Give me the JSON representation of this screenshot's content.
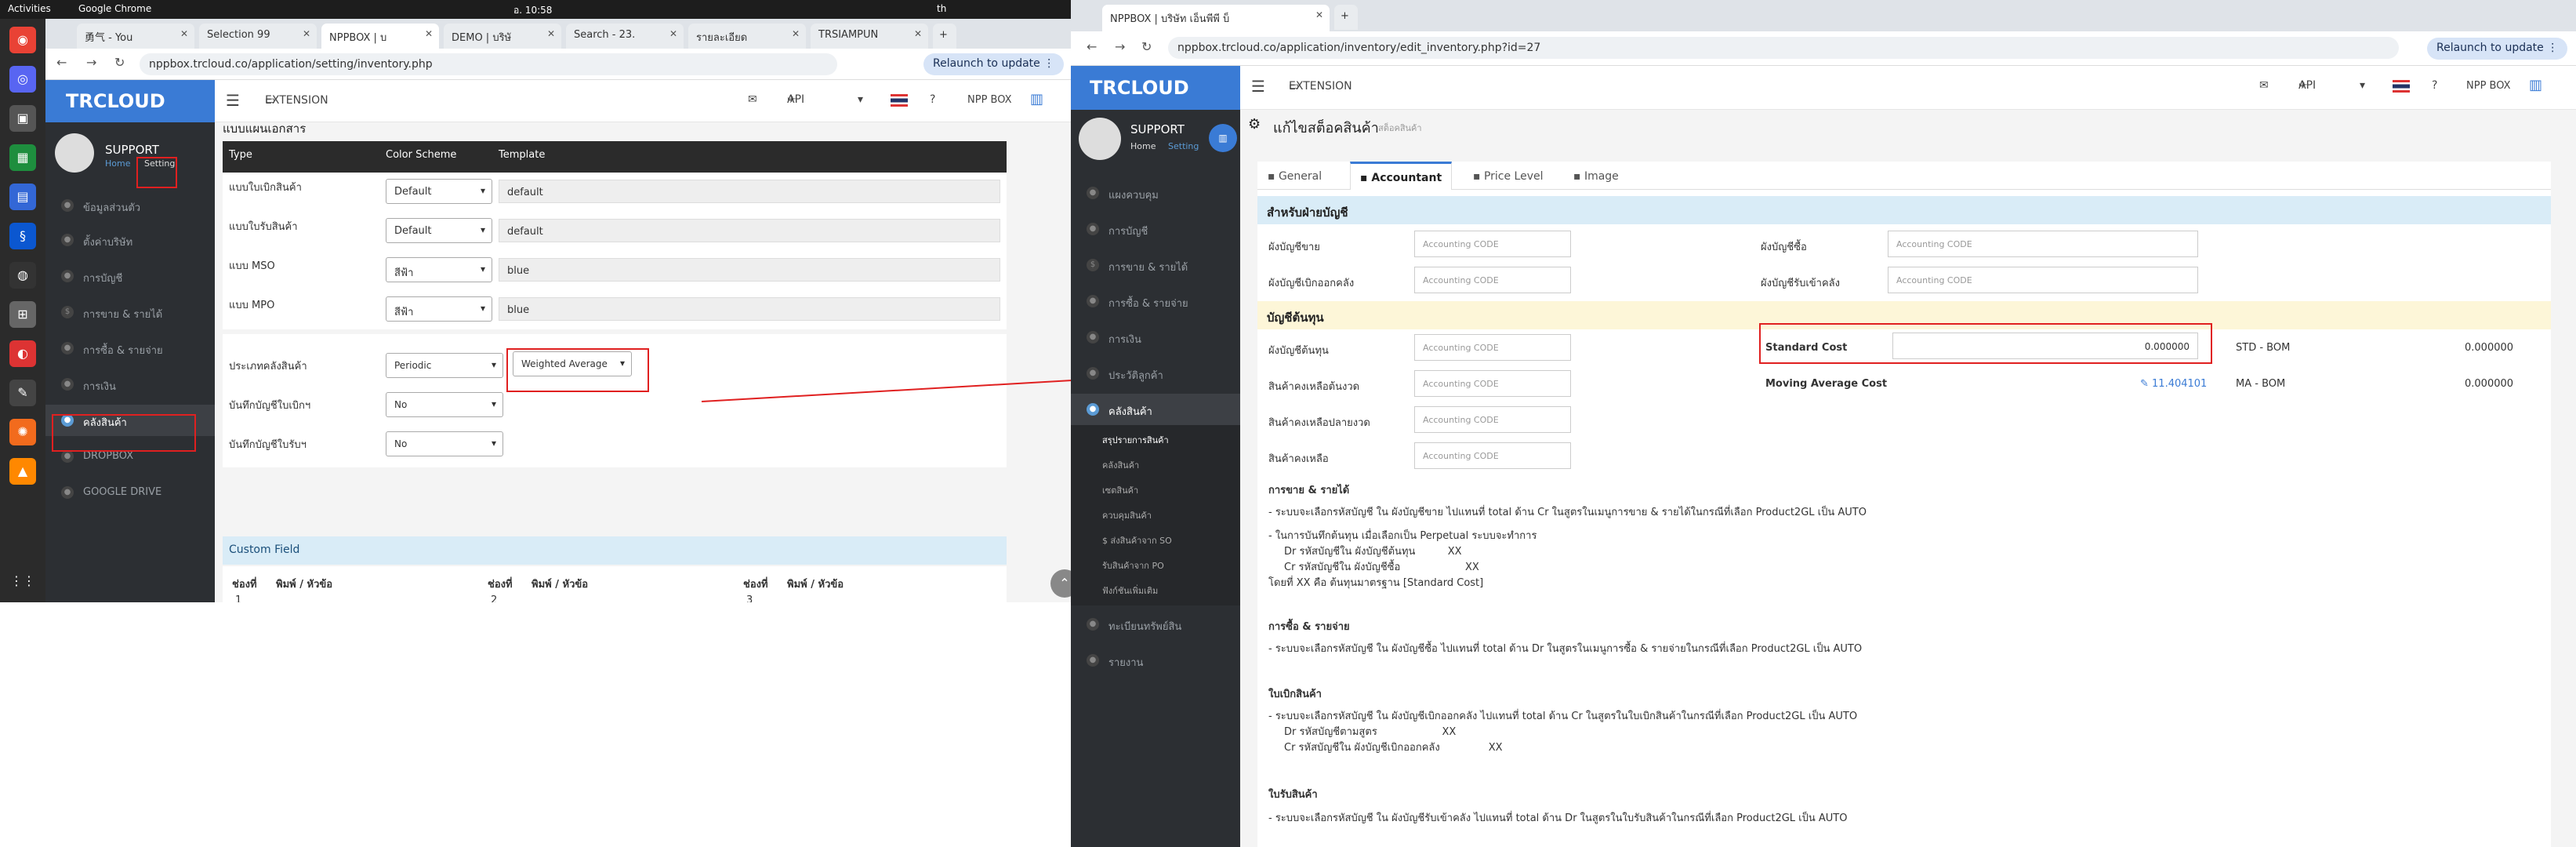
{
  "system": {
    "activities": "Activities",
    "app": "Google Chrome",
    "clock": "อ. 10:58",
    "lang": "th"
  },
  "left": {
    "tabs": [
      "勇气 - You",
      "Selection 99",
      "NPPBOX | บ",
      "DEMO | บริษั",
      "Search - 23.",
      "รายละเอียด",
      "TRSIAMPUN"
    ],
    "url": "nppbox.trcloud.co/application/setting/inventory.php",
    "relaunch": "Relaunch to update",
    "logo": "TRCLOUD",
    "extension": "EXTENSION",
    "api": "API",
    "company": "NPP BOX",
    "user": {
      "name": "SUPPORT",
      "home": "Home",
      "setting": "Setting"
    },
    "menu": [
      "ข้อมูลส่วนตัว",
      "ตั้งค่าบริษัท",
      "การบัญชี",
      "การขาย & รายได้",
      "การซื้อ & รายจ่าย",
      "การเงิน",
      "คลังสินค้า",
      "DROPBOX",
      "GOOGLE DRIVE"
    ],
    "section_title": "แบบแผนเอกสาร",
    "table_head": [
      "Type",
      "Color Scheme",
      "Template"
    ],
    "rows": [
      {
        "type": "แบบใบเบิกสินค้า",
        "scheme": "Default",
        "template": "default"
      },
      {
        "type": "แบบใบรับสินค้า",
        "scheme": "Default",
        "template": "default"
      },
      {
        "type": "แบบ MSO",
        "scheme": "สีฟ้า",
        "template": "blue"
      },
      {
        "type": "แบบ MPO",
        "scheme": "สีฟ้า",
        "template": "blue"
      }
    ],
    "inv_type_label": "ประเภทคลังสินค้า",
    "inv_type": "Periodic",
    "cost_method": "Weighted Average",
    "opt1_label": "บันทึกบัญชีใบเบิกฯ",
    "opt1": "No",
    "opt2_label": "บันทึกบัญชีใบรับฯ",
    "opt2": "No",
    "custom_field": "Custom Field",
    "cf_head": [
      "ช่องที่",
      "พิมพ์ / หัวข้อ",
      "ช่องที่",
      "พิมพ์ / หัวข้อ",
      "ช่องที่",
      "พิมพ์ / หัวข้อ"
    ],
    "cf_nums": [
      "1",
      "2",
      "3"
    ]
  },
  "right": {
    "tab": "NPPBOX | บริษัท เอ็นพีพี บ็",
    "url": "nppbox.trcloud.co/application/inventory/edit_inventory.php?id=27",
    "relaunch": "Relaunch to update",
    "logo": "TRCLOUD",
    "extension": "EXTENSION",
    "api": "API",
    "company": "NPP BOX",
    "user": {
      "name": "SUPPORT",
      "home": "Home",
      "setting": "Setting"
    },
    "menu": [
      "แผงควบคุม",
      "การบัญชี",
      "การขาย & รายได้",
      "การซื้อ & รายจ่าย",
      "การเงิน",
      "ประวัติลูกค้า",
      "คลังสินค้า"
    ],
    "submenu": [
      "สรุปรายการสินค้า",
      "คลังสินค้า",
      "เซตสินค้า",
      "ควบคุมสินค้า",
      "$ ส่งสินค้าจาก SO",
      "รับสินค้าจาก PO",
      "ฟังก์ชันเพิ่มเติม"
    ],
    "menu_after": [
      "ทะเบียนทรัพย์สิน",
      "รายงาน"
    ],
    "page_title": "แก้ไขสต็อคสินค้า",
    "page_sub": "สต็อคสินค้า",
    "tabs": [
      "General",
      "Accountant",
      "Price Level",
      "Image"
    ],
    "sec1": "สำหรับฝ่ายบัญชี",
    "acc_rows": [
      [
        "ผังบัญชีขาย",
        "ผังบัญชีซื้อ"
      ],
      [
        "ผังบัญชีเบิกออกคลัง",
        "ผังบัญชีรับเข้าคลัง"
      ]
    ],
    "placeholder": "Accounting CODE",
    "sec2": "บัญชีต้นทุน",
    "cost_rows": [
      "ผังบัญชีต้นทุน",
      "สินค้าคงเหลือต้นงวด",
      "สินค้าคงเหลือปลายงวด",
      "สินค้าคงเหลือ"
    ],
    "std_cost_label": "Standard Cost",
    "std_cost_val": "0.000000",
    "std_bom": "STD - BOM",
    "std_bom_val": "0.000000",
    "mac_label": "Moving Average Cost",
    "mac_val": "11.404101",
    "ma_bom": "MA - BOM",
    "ma_bom_val": "0.000000",
    "s_sale": "การขาย & รายได้",
    "p_sale": "- ระบบจะเลือกรหัสบัญชี ใน ผังบัญชีขาย ไปแทนที่ total ด้าน Cr ในสูตรในเมนูการขาย & รายได้ในกรณีที่เลือก Product2GL เป็น AUTO",
    "p_perp": "- ในการบันทึกต้นทุน เมื่อเลือกเป็น Perpetual ระบบจะทำการ",
    "p_dr": "Dr รหัสบัญชีใน ผังบัญชีต้นทุน          XX",
    "p_cr": "Cr รหัสบัญชีใน ผังบัญชีซื้อ                    XX",
    "p_xx": "โดยที่ XX คือ ต้นทุนมาตรฐาน [Standard Cost]",
    "s_buy": "การซื้อ & รายจ่าย",
    "p_buy": "- ระบบจะเลือกรหัสบัญชี ใน ผังบัญชีซื้อ ไปแทนที่ total ด้าน Dr ในสูตรในเมนูการซื้อ & รายจ่ายในกรณีที่เลือก Product2GL เป็น AUTO",
    "s_out": "ใบเบิกสินค้า",
    "p_out": "- ระบบจะเลือกรหัสบัญชี ใน ผังบัญชีเบิกออกคลัง ไปแทนที่ total ด้าน Cr ในสูตรในใบเบิกสินค้าในกรณีที่เลือก Product2GL เป็น AUTO",
    "p_out_dr": "Dr รหัสบัญชีตามสูตร                    XX",
    "p_out_cr": "Cr รหัสบัญชีใน ผังบัญชีเบิกออกคลัง               XX",
    "s_in": "ใบรับสินค้า",
    "p_in": "- ระบบจะเลือกรหัสบัญชี ใน ผังบัญชีรับเข้าคลัง ไปแทนที่ total ด้าน Dr ในสูตรในใบรับสินค้าในกรณีที่เลือก Product2GL เป็น AUTO"
  }
}
